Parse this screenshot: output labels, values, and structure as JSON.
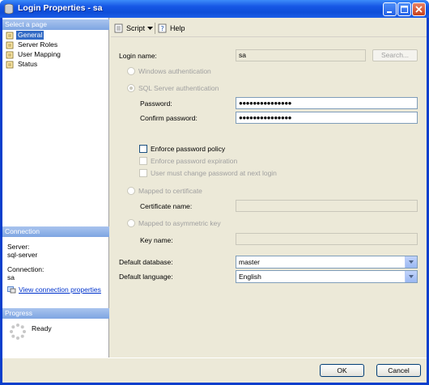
{
  "window": {
    "title": "Login Properties - sa"
  },
  "left": {
    "select_page_header": "Select a page",
    "pages": [
      {
        "label": "General",
        "selected": true
      },
      {
        "label": "Server Roles",
        "selected": false
      },
      {
        "label": "User Mapping",
        "selected": false
      },
      {
        "label": "Status",
        "selected": false
      }
    ],
    "connection_header": "Connection",
    "server_label": "Server:",
    "server_value": "sql-server",
    "connection_label": "Connection:",
    "connection_value": "sa",
    "view_connection_link": "View connection properties",
    "progress_header": "Progress",
    "progress_status": "Ready"
  },
  "toolbar": {
    "script_label": "Script",
    "help_label": "Help"
  },
  "form": {
    "login_name_label": "Login name:",
    "login_name_value": "sa",
    "search_button": "Search...",
    "windows_auth": "Windows authentication",
    "sql_auth": "SQL Server authentication",
    "password_label": "Password:",
    "password_value": "●●●●●●●●●●●●●●●",
    "confirm_password_label": "Confirm password:",
    "confirm_password_value": "●●●●●●●●●●●●●●●",
    "enforce_policy": "Enforce password policy",
    "enforce_expiration": "Enforce password expiration",
    "must_change": "User must change password at next login",
    "mapped_cert": "Mapped to certificate",
    "cert_name_label": "Certificate name:",
    "mapped_asym": "Mapped to asymmetric key",
    "key_name_label": "Key name:",
    "default_db_label": "Default database:",
    "default_db_value": "master",
    "default_lang_label": "Default language:",
    "default_lang_value": "English"
  },
  "buttons": {
    "ok": "OK",
    "cancel": "Cancel"
  }
}
